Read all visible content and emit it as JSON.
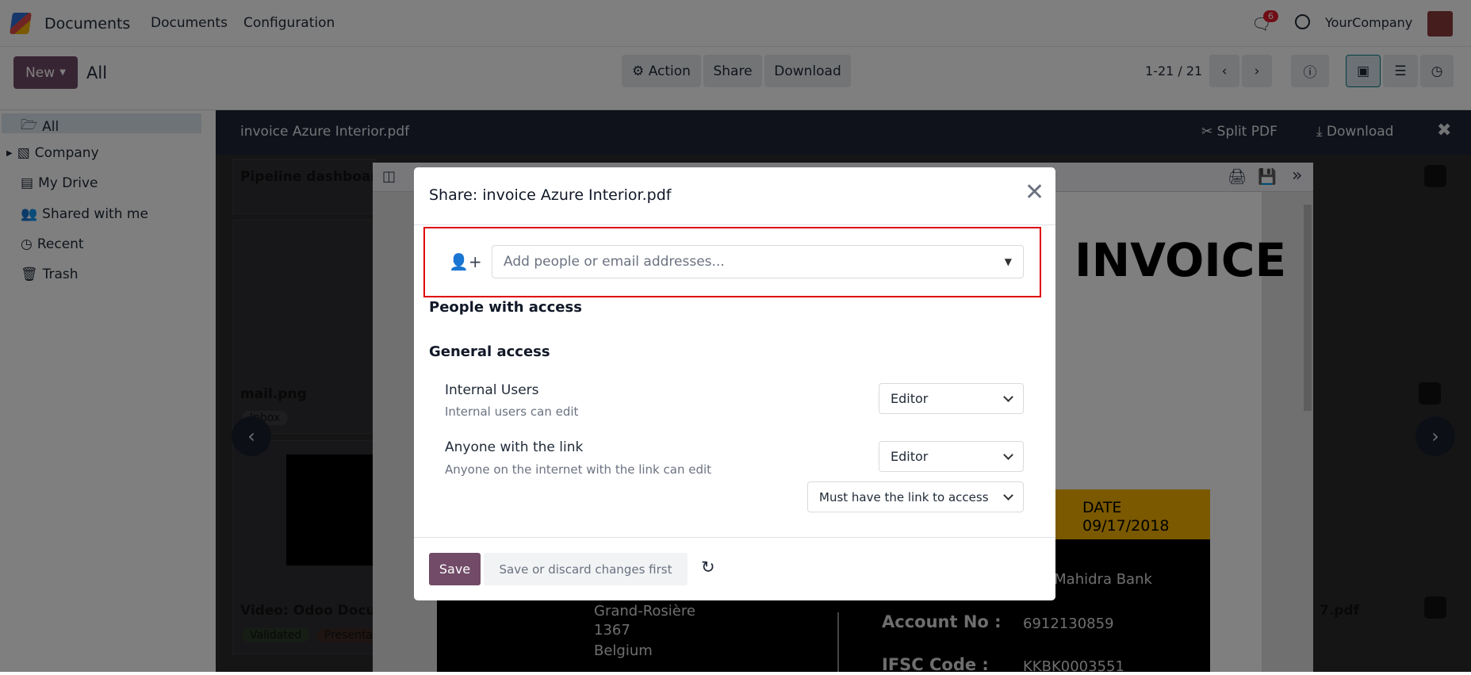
{
  "topnav": {
    "app": "Documents",
    "menu": [
      "Documents",
      "Configuration"
    ],
    "messages_count": "6",
    "company": "YourCompany"
  },
  "control": {
    "new_label": "New",
    "breadcrumb": "All",
    "action_label": "Action",
    "share_label": "Share",
    "download_label": "Download",
    "pager": "1-21 / 21"
  },
  "sidebar": {
    "items": [
      {
        "label": "All"
      },
      {
        "label": "Company"
      },
      {
        "label": "My Drive"
      },
      {
        "label": "Shared with me"
      },
      {
        "label": "Recent"
      },
      {
        "label": "Trash"
      }
    ]
  },
  "viewer": {
    "title": "invoice Azure Interior.pdf",
    "split_label": "Split PDF",
    "download_label": "Download"
  },
  "kanban": {
    "cards": [
      "Pipeline dashboard",
      "mail.png",
      "Video: Odoo Docu",
      "7.pdf"
    ],
    "tags": [
      "Inbox",
      "Validated",
      "Presenta"
    ]
  },
  "invoice": {
    "heading": "INVOICE",
    "date_label": "DATE",
    "date": "09/17/2018",
    "bank": "k Mahidra Bank",
    "address": [
      "Grand-Rosière",
      "1367",
      "Belgium"
    ],
    "account_label": "Account No :",
    "account": "6912130859",
    "ifsc_label": "IFSC Code :",
    "ifsc": "KKBK0003551"
  },
  "modal": {
    "title": "Share: invoice Azure Interior.pdf",
    "invite_placeholder": "Add people or email addresses...",
    "people_heading": "People with access",
    "general_heading": "General access",
    "internal": {
      "label": "Internal Users",
      "desc": "Internal users can edit",
      "role": "Editor"
    },
    "link": {
      "label": "Anyone with the link",
      "desc": "Anyone on the internet with the link can edit",
      "role": "Editor",
      "access": "Must have the link to access"
    },
    "save_label": "Save",
    "discard_hint": "Save or discard changes first"
  },
  "colors": {
    "primary": "#714b67",
    "highlight": "#e00000",
    "gold": "#f5b301"
  }
}
